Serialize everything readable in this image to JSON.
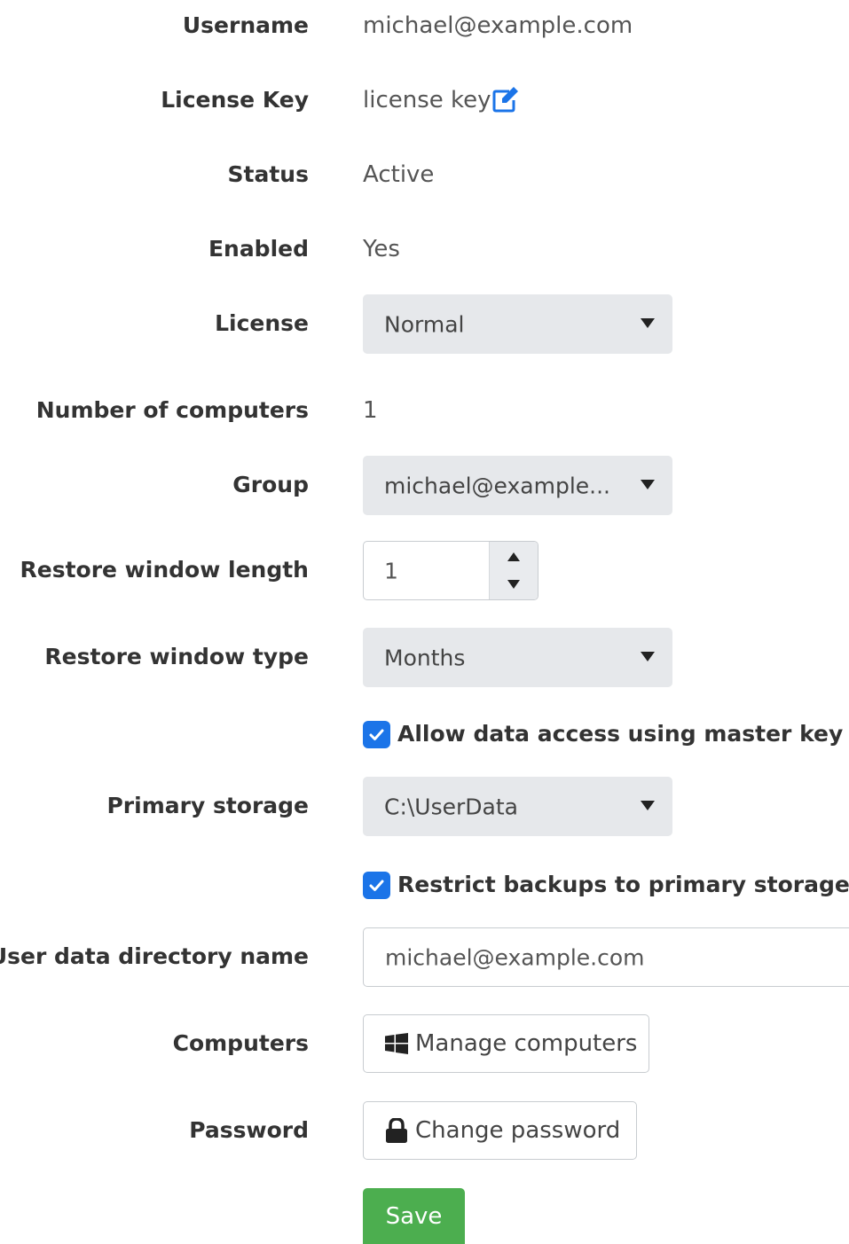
{
  "colors": {
    "accent_blue": "#1b74e8",
    "save_green": "#4cae4f",
    "select_bg": "#e6e8eb",
    "label_text": "#333333",
    "value_text": "#555555"
  },
  "username": {
    "label": "Username",
    "value": "michael@example.com"
  },
  "license_key": {
    "label": "License Key",
    "value": "license key",
    "edit_icon": "edit-icon"
  },
  "status": {
    "label": "Status",
    "value": "Active"
  },
  "enabled": {
    "label": "Enabled",
    "value": "Yes"
  },
  "license": {
    "label": "License",
    "selected": "Normal"
  },
  "number_of_computers": {
    "label": "Number of computers",
    "value": "1"
  },
  "group": {
    "label": "Group",
    "selected": "michael@example..."
  },
  "restore_window_length": {
    "label": "Restore window length",
    "value": "1"
  },
  "restore_window_type": {
    "label": "Restore window type",
    "selected": "Months"
  },
  "allow_master_key": {
    "label": "Allow data access using master key",
    "checked": true
  },
  "primary_storage": {
    "label": "Primary storage",
    "selected": "C:\\UserData"
  },
  "restrict_backups": {
    "label": "Restrict backups to primary storage",
    "checked": true
  },
  "user_data_directory": {
    "label": "User data directory name",
    "value": "michael@example.com"
  },
  "computers": {
    "label": "Computers",
    "button_label": "Manage computers",
    "icon": "windows-icon"
  },
  "password": {
    "label": "Password",
    "button_label": "Change password",
    "icon": "lock-icon"
  },
  "save": {
    "label": "Save"
  }
}
